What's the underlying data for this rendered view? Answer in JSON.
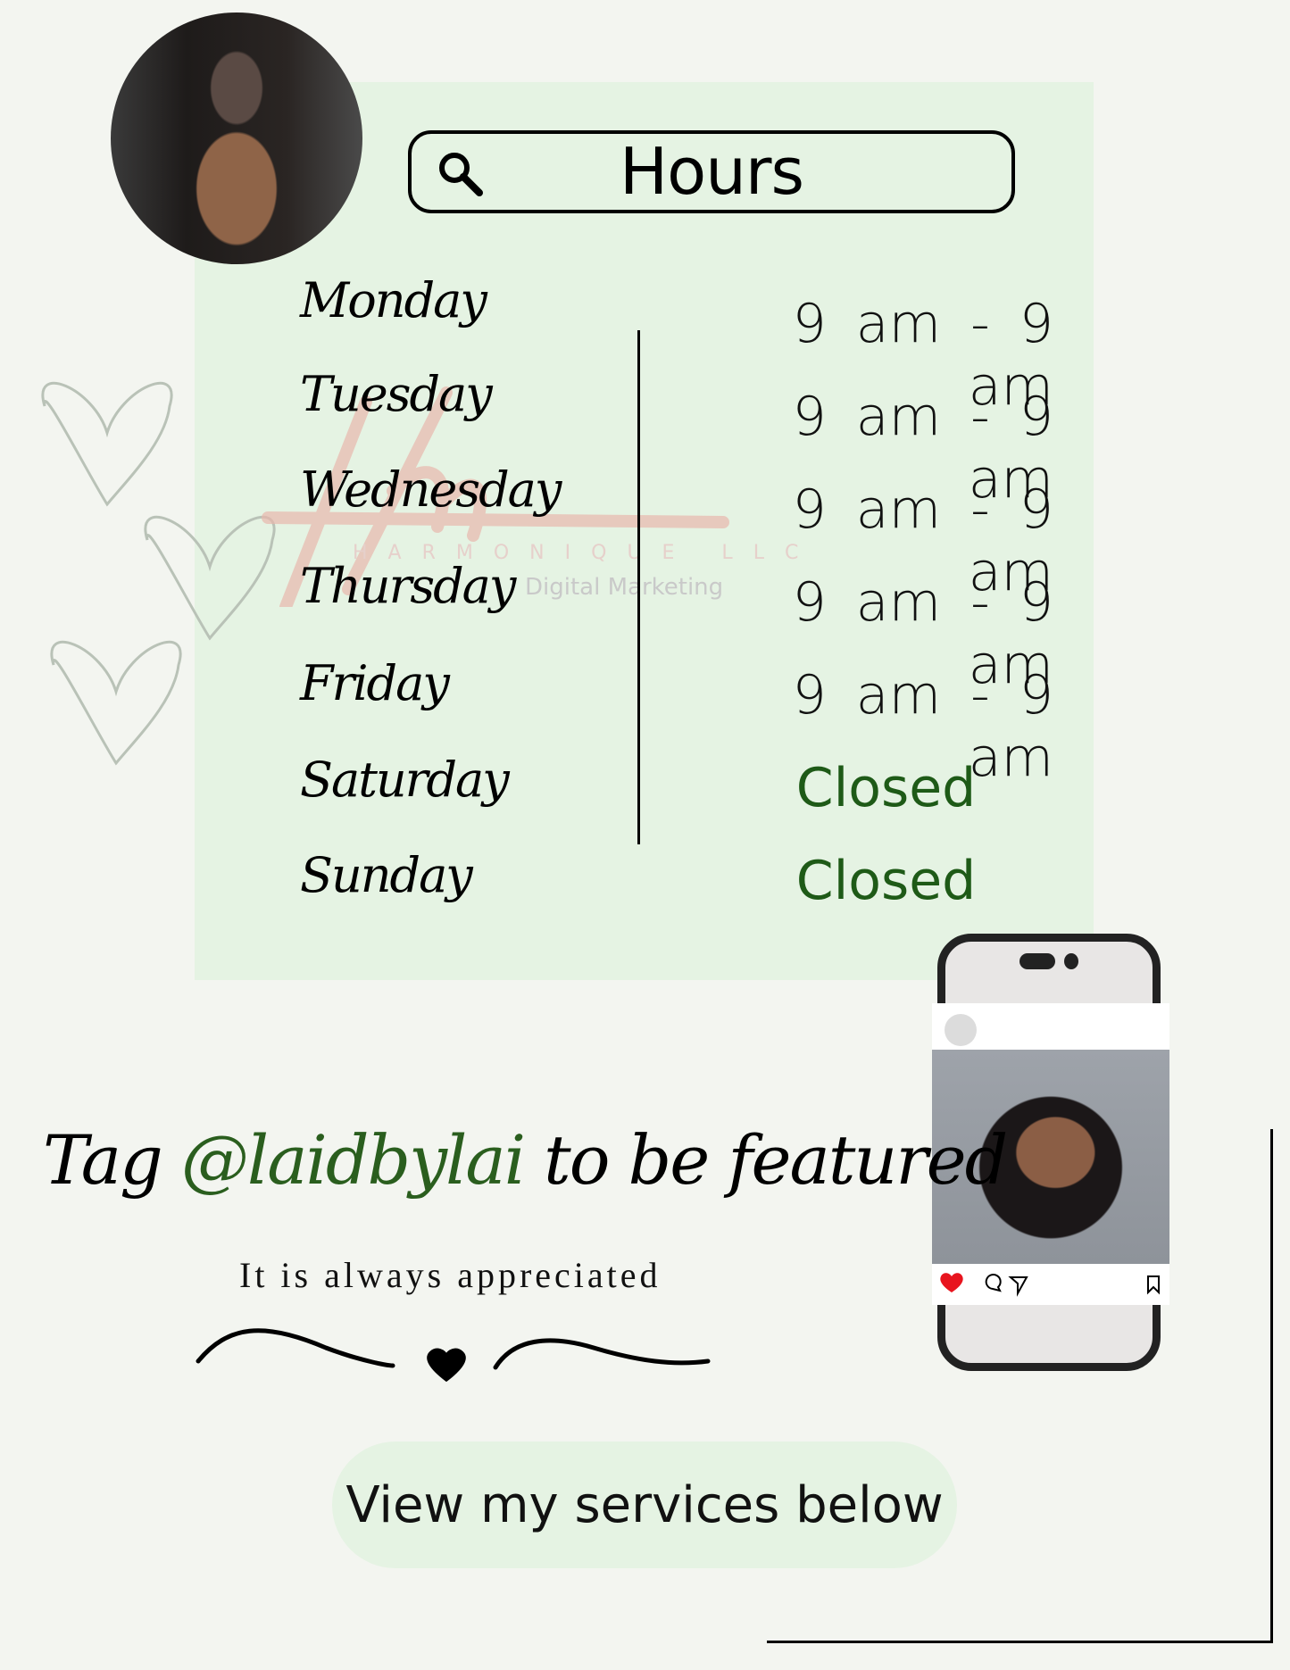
{
  "header": {
    "title": "Hours",
    "search_icon": "magnifier-icon"
  },
  "hours": [
    {
      "day": "Monday",
      "time": "9 am - 9 am"
    },
    {
      "day": "Tuesday",
      "time": "9 am - 9 am"
    },
    {
      "day": "Wednesday",
      "time": "9 am - 9 am"
    },
    {
      "day": "Thursday",
      "time": "9 am - 9 am"
    },
    {
      "day": "Friday",
      "time": "9 am - 9 am"
    },
    {
      "day": "Saturday",
      "time": "Closed"
    },
    {
      "day": "Sunday",
      "time": "Closed"
    }
  ],
  "watermark": {
    "logo": "Hm",
    "name": "HARMONIQUE LLC",
    "sub": "Digital Marketing"
  },
  "tag": {
    "prefix": "Tag ",
    "handle": "@laidbylai",
    "suffix": " to be featured"
  },
  "appreciated": "It is always appreciated",
  "cta": "View my services below",
  "colors": {
    "background": "#f3f5f0",
    "panel": "#e5f3e3",
    "closed": "#1e5a17",
    "handle": "#2a5e1e",
    "heart_like": "#e8141e"
  }
}
